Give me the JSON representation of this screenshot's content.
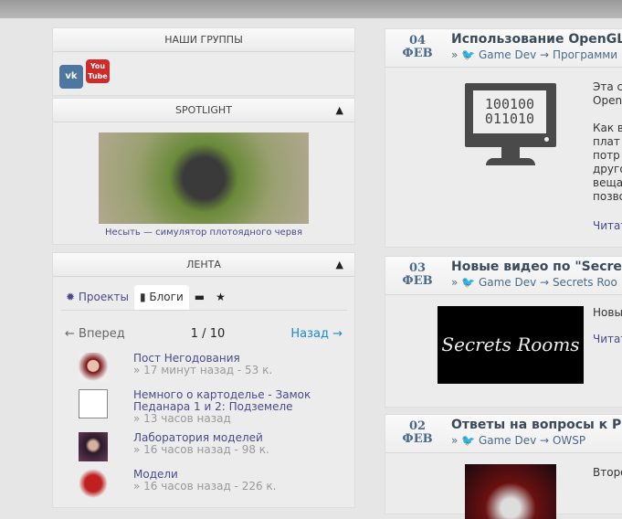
{
  "groups": {
    "title": "НАШИ ГРУППЫ",
    "vk": "vk",
    "youtube": "You Tube"
  },
  "spotlight": {
    "title": "SPOTLIGHT",
    "caption": "Несыть — симулятор плотоядного червя"
  },
  "feed": {
    "title": "ЛЕНТА",
    "tabs": [
      "Проекты",
      "Блоги"
    ],
    "prev": "← Вперед",
    "page": "1 / 10",
    "next": "Назад →",
    "items": [
      {
        "title": "Пост Негодования",
        "meta": "» 17 минут назад - 53 к."
      },
      {
        "title": "Немного о картоделье - Замок Педанара 1 и 2: Подземеле",
        "meta": "» 13 часов назад"
      },
      {
        "title": "Лаборатория моделей",
        "meta": "» 16 часов назад - 98 к."
      },
      {
        "title": "Модели",
        "meta": "» 16 часов назад - 226 к."
      }
    ]
  },
  "posts": [
    {
      "day": "04",
      "month": "ФЕВ",
      "title": "Использование OpenGL",
      "crumb_group": "Game Dev",
      "crumb_section": "Программи",
      "lines": [
        "Эта с",
        "Open",
        "",
        "Как в",
        "плат",
        "потр",
        "друго",
        "веща",
        "позво"
      ],
      "read": "Читать",
      "monitor": [
        "100100",
        "011010"
      ]
    },
    {
      "day": "03",
      "month": "ФЕВ",
      "title": "Новые видео по \"Secret",
      "crumb_group": "Game Dev",
      "crumb_section": "Secrets Roo",
      "lines": [
        "Новы"
      ],
      "read": "Читать",
      "logo": "Secrets Rooms"
    },
    {
      "day": "02",
      "month": "ФЕВ",
      "title": "Ответы на вопросы к Pi",
      "crumb_group": "Game Dev",
      "crumb_section": "OWSP",
      "lines": [
        "Второ"
      ]
    }
  ],
  "crumb_sep": "»",
  "arrow": "→"
}
